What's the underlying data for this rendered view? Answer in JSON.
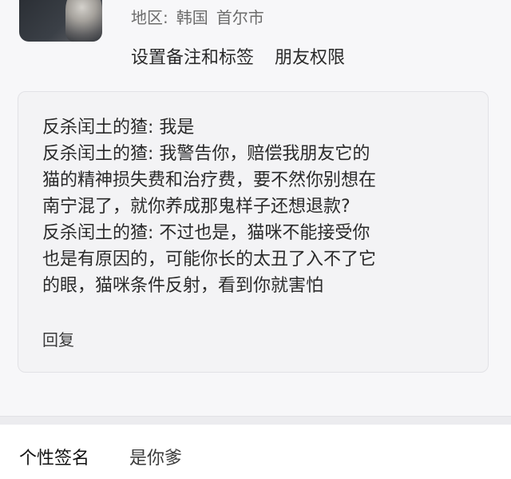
{
  "profile": {
    "region_label": "地区:",
    "region_country": "韩国",
    "region_city": "首尔市",
    "action_notes_tags": "设置备注和标签",
    "action_friend_permissions": "朋友权限"
  },
  "message_card": {
    "lines": [
      "反杀闰土的猹: 我是",
      "反杀闰土的猹: 我警告你，赔偿我朋友它的",
      "猫的精神损失费和治疗费，要不然你别想在",
      "南宁混了，就你养成那鬼样子还想退款?",
      "反杀闰土的猹: 不过也是，猫咪不能接受你",
      "也是有原因的，可能你长的太丑了入不了它",
      "的眼，猫咪条件反射，看到你就害怕"
    ],
    "reply_label": "回复"
  },
  "signature": {
    "label": "个性签名",
    "value": "是你爹"
  }
}
